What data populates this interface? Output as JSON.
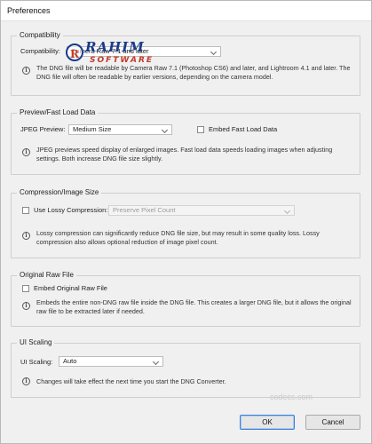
{
  "window": {
    "title": "Preferences"
  },
  "compatibility": {
    "legend": "Compatibility",
    "label": "Compatibility:",
    "selected": "Camera Raw 7.1 and later",
    "note": "The DNG file will be readable by Camera Raw 7.1 (Photoshop CS6) and later, and Lightroom 4.1 and later. The DNG file will often be readable by earlier versions, depending on the camera model."
  },
  "preview": {
    "legend": "Preview/Fast Load Data",
    "jpeg_label": "JPEG Preview:",
    "jpeg_selected": "Medium Size",
    "embed_label": "Embed Fast Load Data",
    "note": "JPEG previews speed display of enlarged images.  Fast load data speeds loading images when adjusting settings.  Both increase DNG file size slightly."
  },
  "compression": {
    "legend": "Compression/Image Size",
    "lossy_label": "Use Lossy Compression:",
    "lossy_selected": "Preserve Pixel Count",
    "note": "Lossy compression can significantly reduce DNG file size, but may result in some quality loss.  Lossy compression also allows optional reduction of image pixel count."
  },
  "original": {
    "legend": "Original Raw File",
    "embed_label": "Embed Original Raw File",
    "note": "Embeds the entire non-DNG raw file inside the DNG file.  This creates a larger DNG file, but it allows the original raw file to be extracted later if needed."
  },
  "ui_scaling": {
    "legend": "UI Scaling",
    "label": "UI Scaling:",
    "selected": "Auto",
    "note": "Changes will take effect the next time you start the DNG Converter."
  },
  "buttons": {
    "ok": "OK",
    "cancel": "Cancel"
  },
  "overlay": {
    "logo_main": "RAHIM",
    "logo_sub": "SOFTWARE",
    "logo_badge": "R",
    "watermark": "codecs.com"
  },
  "icons": {
    "info": "i"
  }
}
